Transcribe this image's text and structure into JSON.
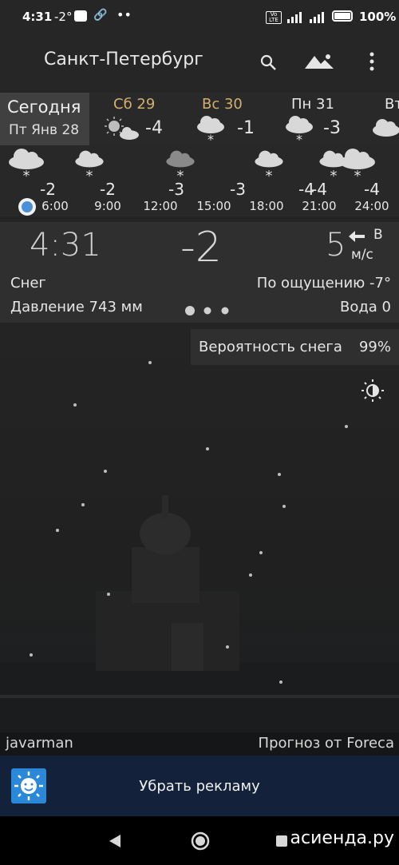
{
  "status_bar": {
    "time": "4:31",
    "temp": "-2°",
    "battery": "100%"
  },
  "app_bar": {
    "city": "Санкт-Петербург",
    "icons": [
      "search-icon",
      "landscape-icon",
      "more-vert-icon"
    ]
  },
  "days": [
    {
      "name": "Сегодня",
      "date": "Пт Янв 28"
    },
    {
      "name": "Сб 29",
      "temp": "-4",
      "icon": "sun-cloud-icon"
    },
    {
      "name": "Вс 30",
      "temp": "-1",
      "icon": "snow-cloud-icon"
    },
    {
      "name": "Пн 31",
      "temp": "-3",
      "icon": "snow-cloud-icon"
    },
    {
      "name": "Вт",
      "icon": "cloud-icon"
    }
  ],
  "hourly": [
    {
      "temp": "-2",
      "time": "6:00"
    },
    {
      "temp": "-2",
      "time": "9:00"
    },
    {
      "temp": "-3",
      "time": "12:00"
    },
    {
      "temp": "-3",
      "time": "15:00"
    },
    {
      "temp": "-4",
      "time": "18:00"
    },
    {
      "temp": "-4",
      "time": "21:00"
    },
    {
      "temp": "-4",
      "time": "24:00"
    }
  ],
  "current": {
    "time": "4:31",
    "temp": "-2",
    "wind_speed": "5",
    "wind_dir": "В",
    "wind_unit": "м/с",
    "condition": "Снег",
    "feels_like": "По ощущению -7°",
    "pressure": "Давление 743 мм",
    "water": "Вода 0",
    "snow_prob_label": "Вероятность снега",
    "snow_prob_value": "99%"
  },
  "footer": {
    "author": "javarman",
    "provider": "Прогноз от Foreca"
  },
  "ad": {
    "label": "Убрать рекламу"
  },
  "watermark": "асиенда.ру",
  "colors": {
    "accent_day": "#d3b070",
    "ad_bar": "#13223a",
    "now_dot": "#4a90d9"
  }
}
